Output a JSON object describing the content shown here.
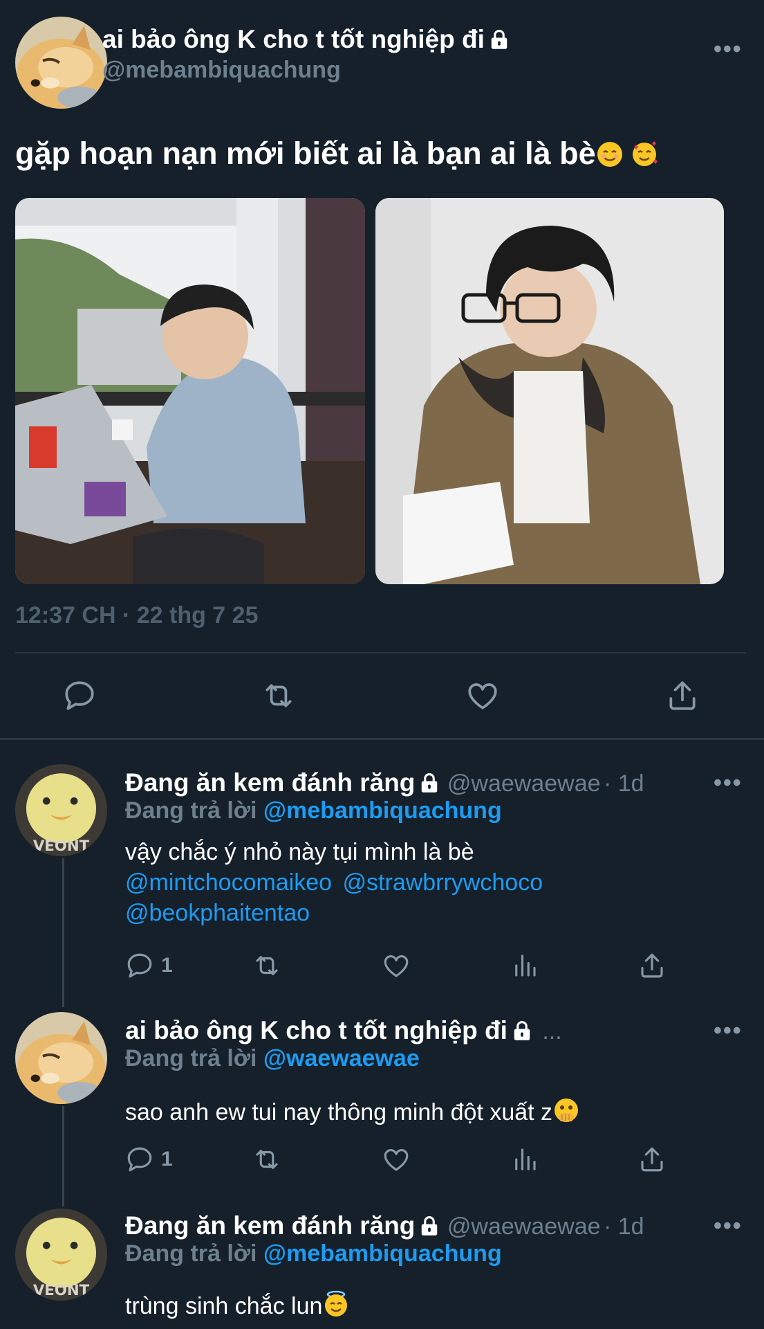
{
  "main_tweet": {
    "author_name": "ai bảo ông K cho t tốt nghiệp đi",
    "author_handle": "@mebambiquachung",
    "text": "gặp hoạn nạn mới biết ai là bạn ai là bè",
    "timestamp": "12:37 CH · 22 thg 7 25",
    "more_label": "•••"
  },
  "replies": [
    {
      "author_name": "Đang ăn kem đánh răng",
      "author_handle": "@waewaewae",
      "age": "· 1d",
      "replying_prefix": "Đang trả lời",
      "replying_to": "@mebambiquachung",
      "text_line1": "vậy chắc ý nhỏ này tụi mình là bè",
      "mention1": "@mintchocomaikeo",
      "mention2": "@strawbrrywchoco",
      "mention3": "@beokphaitentao",
      "reply_count": "1"
    },
    {
      "author_name": "ai bảo ông K cho t tốt nghiệp đi",
      "author_handle_truncated": "...",
      "replying_prefix": "Đang trả lời",
      "replying_to": "@waewaewae",
      "text": "sao anh ew tui nay thông minh đột xuất z",
      "reply_count": "1"
    },
    {
      "author_name": "Đang ăn kem đánh răng",
      "author_handle": "@waewaewae",
      "age": "· 1d",
      "replying_prefix": "Đang trả lời",
      "replying_to": "@mebambiquachung",
      "text": "trùng sinh chắc lun"
    }
  ],
  "colors": {
    "background": "#15202b",
    "accent": "#1d9bf0",
    "muted": "#8899a6"
  }
}
